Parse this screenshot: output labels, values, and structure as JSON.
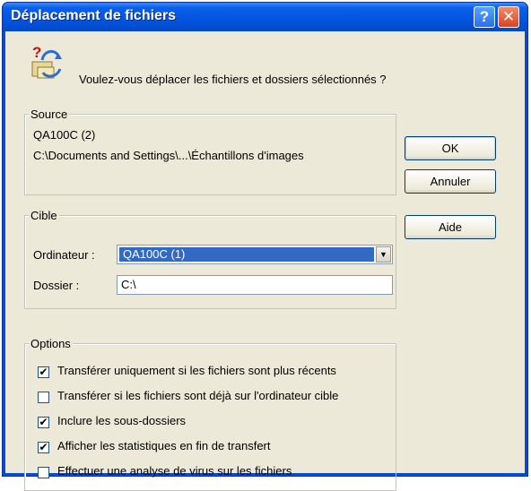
{
  "window": {
    "title": "Déplacement de fichiers",
    "help_glyph": "?",
    "close_glyph": "✕"
  },
  "question": "Voulez-vous déplacer les fichiers et dossiers sélectionnés ?",
  "source": {
    "legend": "Source",
    "machine": "QA100C (2)",
    "path": "C:\\Documents and Settings\\...\\Échantillons d'images"
  },
  "cible": {
    "legend": "Cible",
    "ordinateur_label": "Ordinateur :",
    "ordinateur_value": "QA100C (1)",
    "dossier_label": "Dossier :",
    "dossier_value": "C:\\"
  },
  "buttons": {
    "ok": "OK",
    "annuler": "Annuler",
    "aide": "Aide"
  },
  "options": {
    "legend": "Options",
    "items": [
      {
        "label": "Transférer uniquement si les fichiers sont plus récents",
        "checked": true
      },
      {
        "label": "Transférer si les fichiers sont déjà sur l'ordinateur cible",
        "checked": false
      },
      {
        "label": "Inclure les sous-dossiers",
        "checked": true
      },
      {
        "label": "Afficher les statistiques en fin de transfert",
        "checked": true
      },
      {
        "label": "Effectuer une analyse de virus sur les fichiers",
        "checked": false
      }
    ]
  },
  "colors": {
    "titlebar": "#0554e0",
    "dialog_bg": "#ece9d8",
    "selection": "#316ac5"
  },
  "icons": {
    "question": "question-move-icon",
    "combo_arrow": "chevron-down-icon",
    "check": "check-icon"
  }
}
